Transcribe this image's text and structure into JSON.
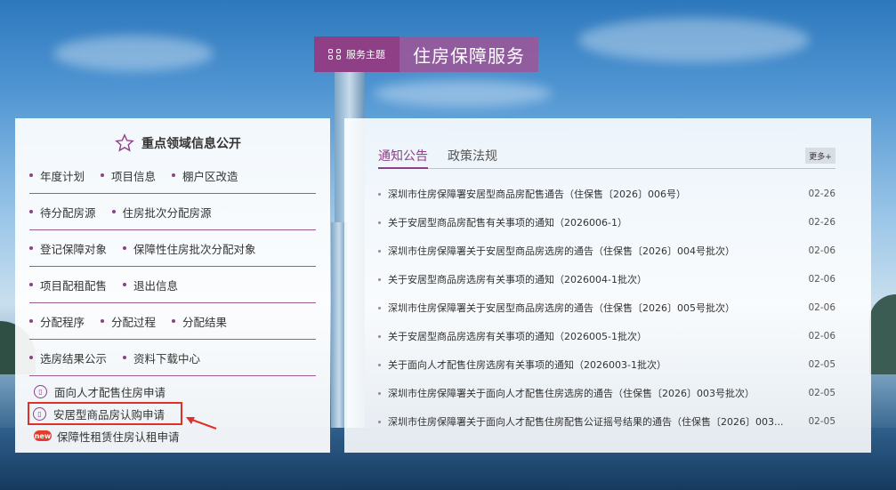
{
  "header": {
    "tag_label": "服务主题",
    "title": "住房保障服务"
  },
  "left_panel": {
    "heading": "重点领域信息公开",
    "rows": [
      [
        "年度计划",
        "项目信息",
        "棚户区改造"
      ],
      [
        "待分配房源",
        "住房批次分配房源"
      ],
      [
        "登记保障对象",
        "保障性住房批次分配对象"
      ],
      [
        "项目配租配售",
        "退出信息"
      ],
      [
        "分配程序",
        "分配过程",
        "分配结果"
      ],
      [
        "选房结果公示",
        "资料下载中心"
      ]
    ],
    "apply_items": [
      {
        "label": "面向人才配售住房申请",
        "icon": "document-icon"
      },
      {
        "label": "安居型商品房认购申请",
        "icon": "document-icon"
      },
      {
        "label": "保障性租赁住房认租申请",
        "icon": "new-badge-icon",
        "badge": "new"
      }
    ]
  },
  "right_panel": {
    "tabs": [
      "通知公告",
      "政策法规"
    ],
    "more_label": "更多+",
    "news": [
      {
        "title": "深圳市住房保障署安居型商品房配售通告（住保售〔2026〕006号）",
        "date": "02-26"
      },
      {
        "title": "关于安居型商品房配售有关事项的通知（2026006-1）",
        "date": "02-26"
      },
      {
        "title": "深圳市住房保障署关于安居型商品房选房的通告（住保售〔2026〕004号批次）",
        "date": "02-06"
      },
      {
        "title": "关于安居型商品房选房有关事项的通知（2026004-1批次）",
        "date": "02-06"
      },
      {
        "title": "深圳市住房保障署关于安居型商品房选房的通告（住保售〔2026〕005号批次）",
        "date": "02-06"
      },
      {
        "title": "关于安居型商品房选房有关事项的通知（2026005-1批次）",
        "date": "02-06"
      },
      {
        "title": "关于面向人才配售住房选房有关事项的通知（2026003-1批次）",
        "date": "02-05"
      },
      {
        "title": "深圳市住房保障署关于面向人才配售住房选房的通告（住保售〔2026〕003号批次）",
        "date": "02-05"
      },
      {
        "title": "深圳市住房保障署关于面向人才配售住房配售公证摇号结果的通告（住保售〔2026〕003...",
        "date": "02-05"
      }
    ]
  }
}
